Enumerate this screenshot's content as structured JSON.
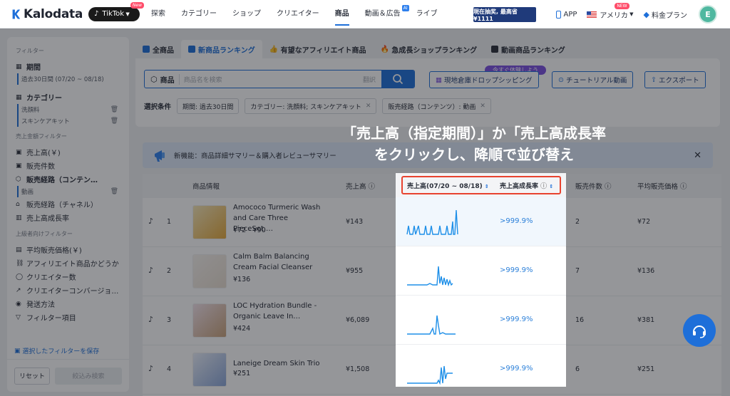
{
  "header": {
    "logo": "Kalodata",
    "platform": "TikTok",
    "platform_badge": "New",
    "nav": [
      "探索",
      "カテゴリー",
      "ショップ",
      "クリエイター",
      "商品",
      "動画＆広告",
      "ライブ"
    ],
    "nav_ai_badge": "AI",
    "promo": "現在抽奖, 最高省 ¥1111",
    "app": "APP",
    "region": "アメリカ",
    "region_badge": "NEW",
    "plan": "料金プラン",
    "avatar_letter": "E"
  },
  "sidebar": {
    "filter_title": "フィルター",
    "period_label": "期間",
    "period_value": "過去30日間 (07/20 ~ 08/18)",
    "category_label": "カテゴリー",
    "category_items": [
      "洗顔料",
      "スキンケアキット"
    ],
    "sales_filter_title": "売上金額フィルター",
    "sales_items": [
      "売上高(￥)",
      "販売件数"
    ],
    "channel_label": "販売経路（コンテン…",
    "channel_item": "動画",
    "channel2": "販売経路（チャネル）",
    "growth": "売上高成長率",
    "advanced_title": "上級者向けフィルター",
    "advanced_items": [
      "平均販売価格(￥)",
      "アフィリエイト商品かどうか",
      "クリエイター数",
      "クリエイターコンバージョ…",
      "発送方法",
      "フィルター項目"
    ],
    "save_label": "選択したフィルターを保存",
    "reset_label": "リセット",
    "apply_label": "絞込み検索"
  },
  "tabs": [
    "全商品",
    "新商品ランキング",
    "有望なアフィリエイト商品",
    "急成長ショップランキング",
    "動画商品ランキング"
  ],
  "search": {
    "label": "商品",
    "placeholder": "商品名を検索",
    "translate": "翻訳",
    "warehouse_btn": "現地倉庫ドロップシッピング",
    "try_tag": "今すぐ体験しよう",
    "tutorial_btn": "チュートリアル動画",
    "export_btn": "エクスポート"
  },
  "conditions": {
    "label": "選択条件",
    "chips": [
      "期間: 過去30日間",
      "カテゴリー: 洗顔料; スキンケアキット",
      "販売経路（コンテンツ）: 動画"
    ]
  },
  "notice": "新機能：商品詳細サマリー＆購入者レビューサマリー",
  "callout": {
    "line1": "「売上高（指定期間）」か「売上高成長率",
    "line2": "をクリックし、降順で並び替え"
  },
  "table": {
    "headers": [
      "商品情報",
      "売上高",
      "売上高(07/20 ~ 08/18)",
      "売上高成長率",
      "販売件数",
      "平均販売価格"
    ],
    "rows": [
      {
        "rank": "1",
        "name": "Amococo Turmeric Wash and Care Three PieceSet,…",
        "price": "¥72 - ¥90",
        "sales": "¥143",
        "rate": ">999.9%",
        "count": "2",
        "avg": "¥72"
      },
      {
        "rank": "2",
        "name": "Calm Balm Balancing Cream Facial Cleanser",
        "price": "¥136",
        "sales": "¥955",
        "rate": ">999.9%",
        "count": "7",
        "avg": "¥136"
      },
      {
        "rank": "3",
        "name": "LOC Hydration Bundle - Organic Leave In…",
        "price": "¥424",
        "sales": "¥6,089",
        "rate": ">999.9%",
        "count": "16",
        "avg": "¥381"
      },
      {
        "rank": "4",
        "name": "Laneige Dream Skin Trio",
        "price": "¥251",
        "sales": "¥1,508",
        "rate": ">999.9%",
        "count": "6",
        "avg": "¥251"
      }
    ]
  },
  "colors": {
    "accent": "#1e6fd9",
    "highlight": "#e8432f"
  }
}
